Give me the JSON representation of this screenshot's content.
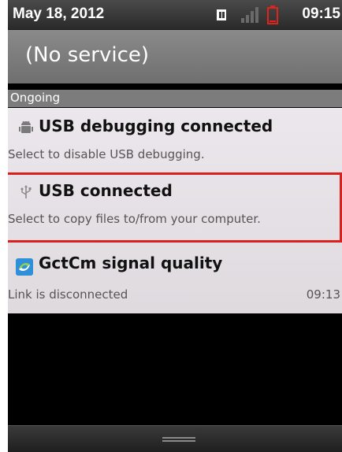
{
  "status_bar": {
    "date": "May 18, 2012",
    "time": "09:15",
    "icons": [
      "data-icon",
      "signal-icon",
      "battery-low-icon"
    ],
    "battery_color": "#e0231c"
  },
  "carrier": {
    "label": "(No service)"
  },
  "section": {
    "label": "Ongoing"
  },
  "notifications": [
    {
      "icon": "android-debug-icon",
      "title": "USB debugging connected",
      "description": "Select to disable USB debugging."
    },
    {
      "icon": "usb-icon",
      "title": "USB connected",
      "description": "Select to copy files to/from your computer.",
      "highlighted": true,
      "highlight_color": "#d8201c"
    },
    {
      "icon": "gctcm-app-icon",
      "title": "GctCm signal quality",
      "description": "Link is disconnected",
      "time": "09:13"
    }
  ],
  "bottom": {
    "handle_icon": "drag-handle-icon"
  }
}
